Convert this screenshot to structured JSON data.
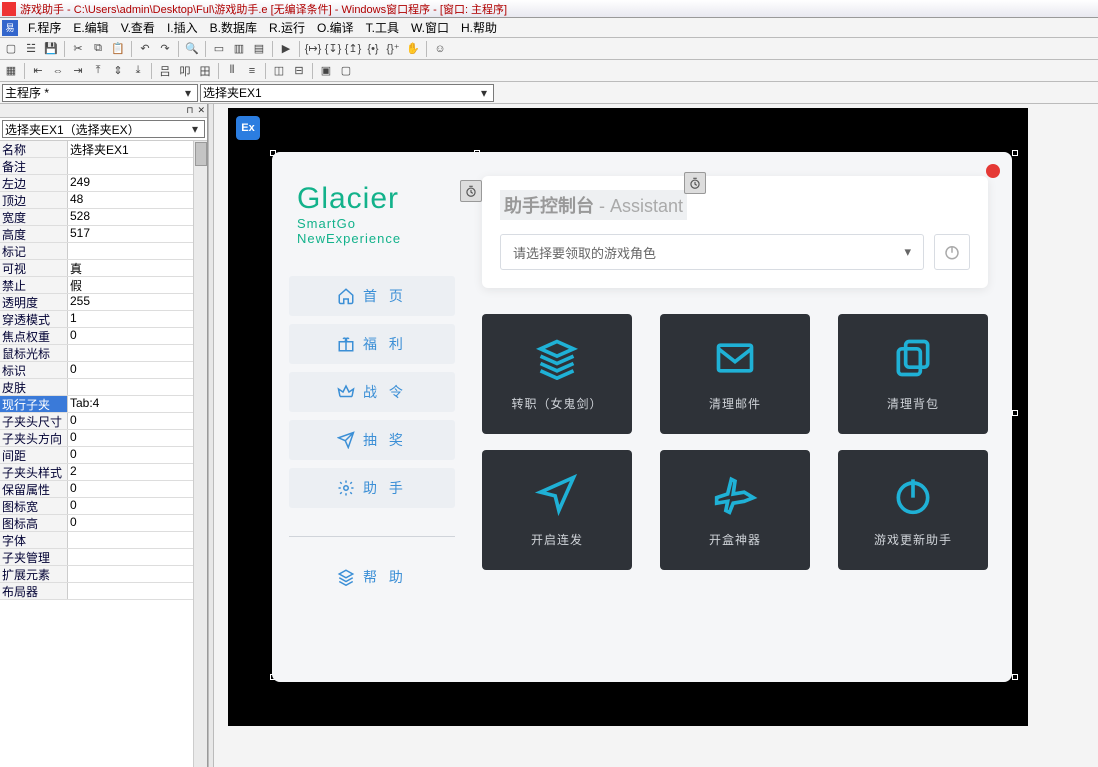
{
  "title": "游戏助手 - C:\\Users\\admin\\Desktop\\Ful\\游戏助手.e [无编译条件] - Windows窗口程序 - [窗口: 主程序]",
  "menu": [
    "F.程序",
    "E.编辑",
    "V.查看",
    "I.插入",
    "B.数据库",
    "R.运行",
    "O.编译",
    "T.工具",
    "W.窗口",
    "H.帮助"
  ],
  "dropdowns": {
    "left": "主程序 *",
    "right": "选择夹EX1"
  },
  "panel": {
    "selector": "选择夹EX1（选择夹EX）",
    "props": [
      {
        "k": "名称",
        "v": "选择夹EX1"
      },
      {
        "k": "备注",
        "v": ""
      },
      {
        "k": "左边",
        "v": "249"
      },
      {
        "k": "顶边",
        "v": "48"
      },
      {
        "k": "宽度",
        "v": "528"
      },
      {
        "k": "高度",
        "v": "517"
      },
      {
        "k": "标记",
        "v": ""
      },
      {
        "k": "可视",
        "v": "真"
      },
      {
        "k": "禁止",
        "v": "假"
      },
      {
        "k": "透明度",
        "v": "255"
      },
      {
        "k": "穿透模式",
        "v": "1"
      },
      {
        "k": "焦点权重",
        "v": "0"
      },
      {
        "k": "鼠标光标",
        "v": ""
      },
      {
        "k": "标识",
        "v": "0"
      },
      {
        "k": "皮肤",
        "v": ""
      },
      {
        "k": "现行子夹",
        "v": "Tab:4",
        "hl": true
      },
      {
        "k": "子夹头尺寸",
        "v": "0"
      },
      {
        "k": "子夹头方向",
        "v": "0"
      },
      {
        "k": "间距",
        "v": "0"
      },
      {
        "k": "子夹头样式",
        "v": "2"
      },
      {
        "k": "保留属性",
        "v": "0"
      },
      {
        "k": "图标宽",
        "v": "0"
      },
      {
        "k": "图标高",
        "v": "0"
      },
      {
        "k": "字体",
        "v": ""
      },
      {
        "k": "子夹管理",
        "v": ""
      },
      {
        "k": "扩展元素",
        "v": ""
      },
      {
        "k": "布局器",
        "v": ""
      }
    ]
  },
  "app": {
    "badge": "Ex",
    "brand": {
      "b1": "Glacier",
      "b2": "SmartGo",
      "b3": "NewExperience"
    },
    "nav": [
      {
        "icon": "home",
        "label": "首 页"
      },
      {
        "icon": "gift",
        "label": "福 利"
      },
      {
        "icon": "crown",
        "label": "战 令"
      },
      {
        "icon": "plane",
        "label": "抽 奖"
      },
      {
        "icon": "gear",
        "label": "助 手"
      }
    ],
    "help": "帮 助",
    "console": {
      "title": "助手控制台",
      "sub": " -  Assistant",
      "placeholder": "请选择要领取的游戏角色"
    },
    "tiles": [
      {
        "label": "转职（女鬼剑）"
      },
      {
        "label": "清理邮件"
      },
      {
        "label": "清理背包"
      },
      {
        "label": "开启连发"
      },
      {
        "label": "开盒神器"
      },
      {
        "label": "游戏更新助手"
      }
    ]
  }
}
